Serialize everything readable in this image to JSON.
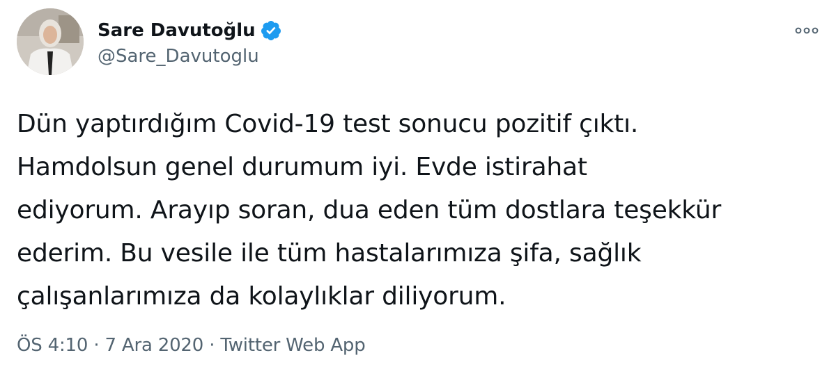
{
  "tweet": {
    "author": {
      "display_name": "Sare Davutoğlu",
      "handle": "@Sare_Davutoglu",
      "verified": true,
      "avatar_icon": "profile-photo"
    },
    "text_lines": [
      "Dün yaptırdığım Covid-19 test sonucu pozitif çıktı.",
      "Hamdolsun genel durumum iyi. Evde istirahat",
      "ediyorum. Arayıp soran, dua eden tüm dostlara teşekkür",
      "ederim. Bu vesile ile tüm hastalarımıza şifa, sağlık",
      "çalışanlarımıza da kolaylıklar diliyorum."
    ],
    "meta": {
      "time": "ÖS 4:10",
      "separator": "·",
      "date": "7 Ara 2020",
      "source": "Twitter Web App"
    },
    "more_icon": "more-options-icon",
    "colors": {
      "verified_badge": "#1d9bf0",
      "secondary_text": "#536471",
      "primary_text": "#0f1419"
    }
  }
}
